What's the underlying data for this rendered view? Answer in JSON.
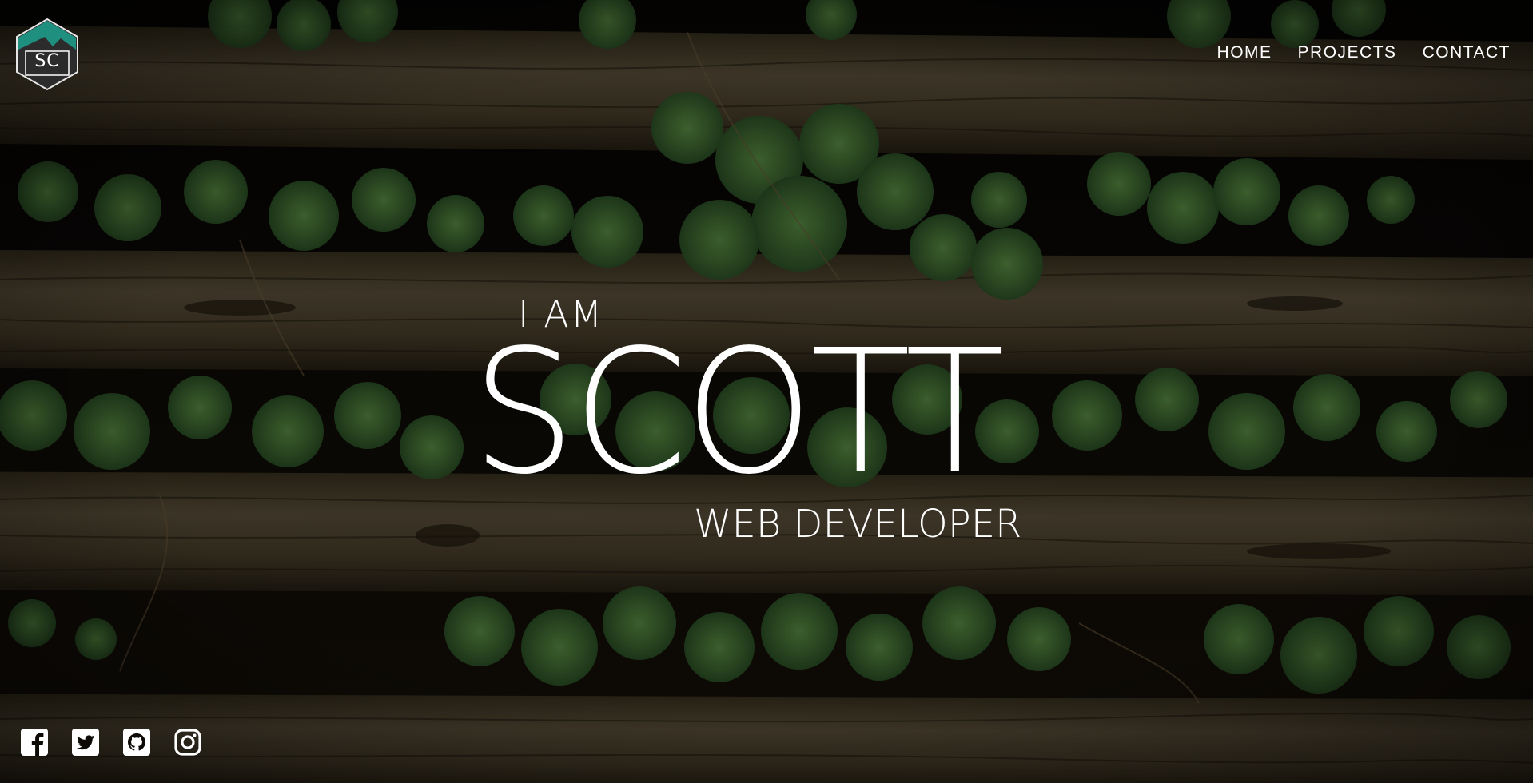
{
  "logo": {
    "initials": "SC",
    "accent": "#1f8f7f"
  },
  "nav": {
    "items": [
      {
        "label": "HOME"
      },
      {
        "label": "PROJECTS"
      },
      {
        "label": "CONTACT"
      }
    ]
  },
  "hero": {
    "intro": "I AM",
    "name": "SCOTT",
    "role": "WEB DEVELOPER"
  },
  "social": {
    "icons": [
      "facebook-icon",
      "twitter-icon",
      "github-icon",
      "instagram-icon"
    ]
  },
  "colors": {
    "text": "#ffffff",
    "wood": "#3b3322",
    "ivy": "#2f5a2a"
  }
}
